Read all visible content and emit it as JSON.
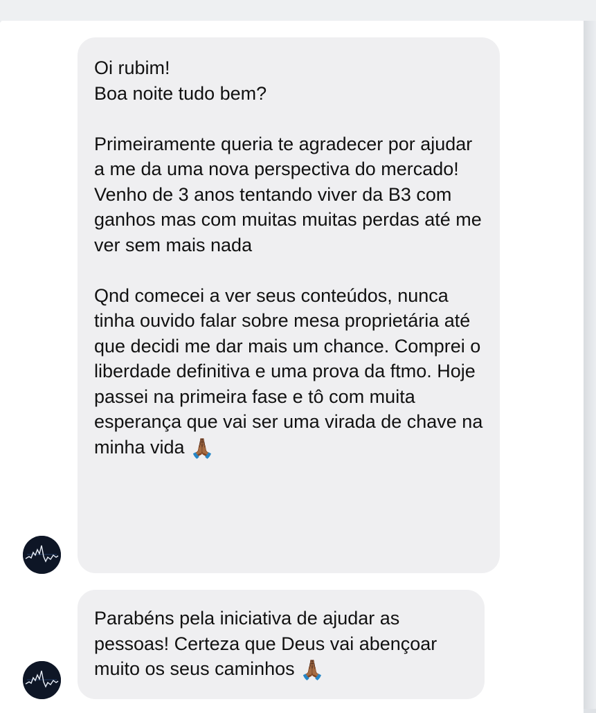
{
  "messages": [
    {
      "text": "Oi rubim!\nBoa noite tudo bem?\n\nPrimeiramente queria te agradecer por ajudar a me da uma nova perspectiva do mercado!\nVenho de 3 anos tentando viver da B3 com ganhos mas com muitas muitas perdas até me ver sem mais nada\n\nQnd comecei a ver seus conteúdos, nunca tinha ouvido falar sobre mesa proprietária até que decidi me dar mais um chance. Comprei o liberdade definitiva e uma prova da ftmo. Hoje passei na primeira fase e tô com muita esperança que vai ser uma virada de chave na minha vida",
      "emoji": "🙏🏾"
    },
    {
      "text": "Parabéns pela iniciativa de ajudar as pessoas! Certeza que Deus vai abençoar muito os seus caminhos",
      "emoji": "🙏🏾"
    }
  ],
  "avatar_icon": "stock-chart-icon",
  "colors": {
    "bubble": "#efeff1",
    "text": "#111111",
    "avatar_bg": "#0e1626"
  }
}
